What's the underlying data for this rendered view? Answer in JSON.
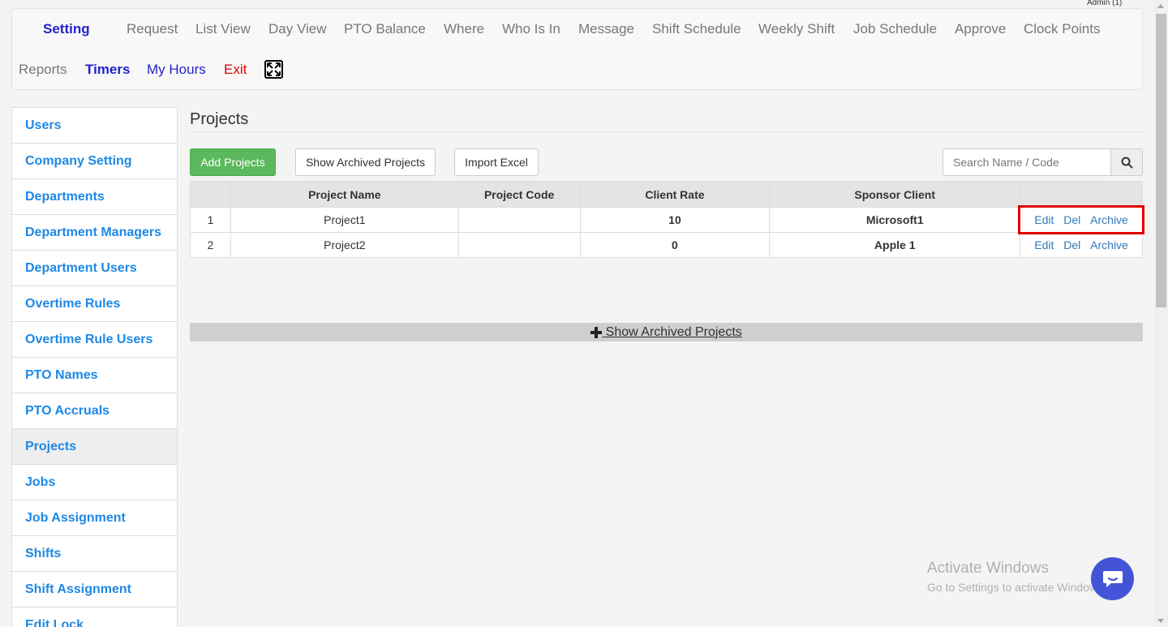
{
  "header": {
    "admin_label": "Admin (1)"
  },
  "topnav": {
    "row1": [
      "Setting",
      "Request",
      "List View",
      "Day View",
      "PTO Balance",
      "Where",
      "Who Is In",
      "Message",
      "Shift Schedule",
      "Weekly Shift",
      "Job Schedule",
      "Approve",
      "Clock Points"
    ],
    "row2": [
      "Reports",
      "Timers",
      "My Hours",
      "Exit"
    ]
  },
  "sidebar": {
    "items": [
      "Users",
      "Company Setting",
      "Departments",
      "Department Managers",
      "Department Users",
      "Overtime Rules",
      "Overtime Rule Users",
      "PTO Names",
      "PTO Accruals",
      "Projects",
      "Jobs",
      "Job Assignment",
      "Shifts",
      "Shift Assignment",
      "Edit Lock"
    ],
    "active": "Projects"
  },
  "main": {
    "title": "Projects",
    "toolbar": {
      "add_label": "Add Projects",
      "archived_label": "Show Archived Projects",
      "import_label": "Import Excel",
      "search_placeholder": "Search Name / Code"
    },
    "table": {
      "columns": [
        "",
        "Project Name",
        "Project Code",
        "Client Rate",
        "Sponsor Client",
        ""
      ],
      "rows": [
        {
          "num": "1",
          "name": "Project1",
          "code": "",
          "rate": "10",
          "client": "Microsoft1"
        },
        {
          "num": "2",
          "name": "Project2",
          "code": "",
          "rate": "0",
          "client": "Apple 1"
        }
      ],
      "actions": {
        "edit": "Edit",
        "del": "Del",
        "archive": "Archive"
      }
    },
    "archived_bar_label": " Show Archived Projects"
  },
  "watermark": {
    "line1": "Activate Windows",
    "line2": "Go to Settings to activate Windows."
  },
  "colors": {
    "accent_blue": "#1e88e5",
    "active_nav": "#2222cc",
    "exit_red": "#e00000",
    "add_green": "#5cb85c",
    "chat_blue": "#4355d6",
    "highlight_red": "#e00000"
  }
}
